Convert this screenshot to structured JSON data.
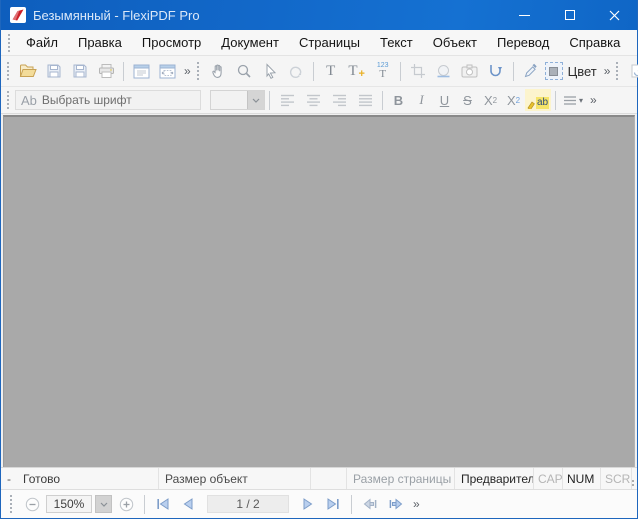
{
  "window": {
    "title": "Безымянный - FlexiPDF Pro",
    "logo": "flexipdf-logo",
    "controls": [
      "minimize",
      "maximize",
      "close"
    ]
  },
  "menu": {
    "items": [
      "Файл",
      "Правка",
      "Просмотр",
      "Документ",
      "Страницы",
      "Текст",
      "Объект",
      "Перевод",
      "Справка"
    ]
  },
  "toolbar_main": {
    "icons": [
      "open",
      "save",
      "save-as",
      "print",
      "page-view",
      "page-thumbnails",
      "hand",
      "zoom",
      "select",
      "undo",
      "edit-text",
      "add-text",
      "paragraph-numbering",
      "crop",
      "image",
      "snapshot",
      "reflow",
      "color-picker",
      "color-swatch",
      "page-refresh"
    ],
    "edit_text_label": "T",
    "add_text_label": "T",
    "add_text_plus": "+",
    "numbering_top": "123",
    "numbering_bottom": "T",
    "color_label": "Цвет",
    "overflow": "»"
  },
  "toolbar_format": {
    "ab_icon": "Ab",
    "font_placeholder": "Выбрать шрифт",
    "bold": "B",
    "italic": "I",
    "underline": "U",
    "strike": "S",
    "sup_base": "X",
    "sup_mark": "2",
    "sub_base": "X",
    "sub_mark": "2",
    "highlight_label": "ab",
    "overflow": "»"
  },
  "statusbar": {
    "edit_flag": "-",
    "ready": "Готово",
    "object_size": "Размер объект",
    "page_size": "Размер страницы",
    "preview": "Предварител",
    "caps": "CAP",
    "num": "NUM",
    "scroll": "SCRL"
  },
  "bottom_toolbar": {
    "zoom_level": "150%",
    "page_indicator": "1 / 2",
    "overflow": "»"
  },
  "colors": {
    "titlebar_blue": "#1268c9",
    "window_border": "#1e66bd",
    "canvas_gray": "#a9a9a9",
    "folder_tan": "#f3dc9a",
    "highlight_yellow": "#f5e468",
    "nav_blue_fill": "#b9cfee",
    "nav_blue_stroke": "#7d9dc9",
    "logo_red": "#cc2128"
  }
}
